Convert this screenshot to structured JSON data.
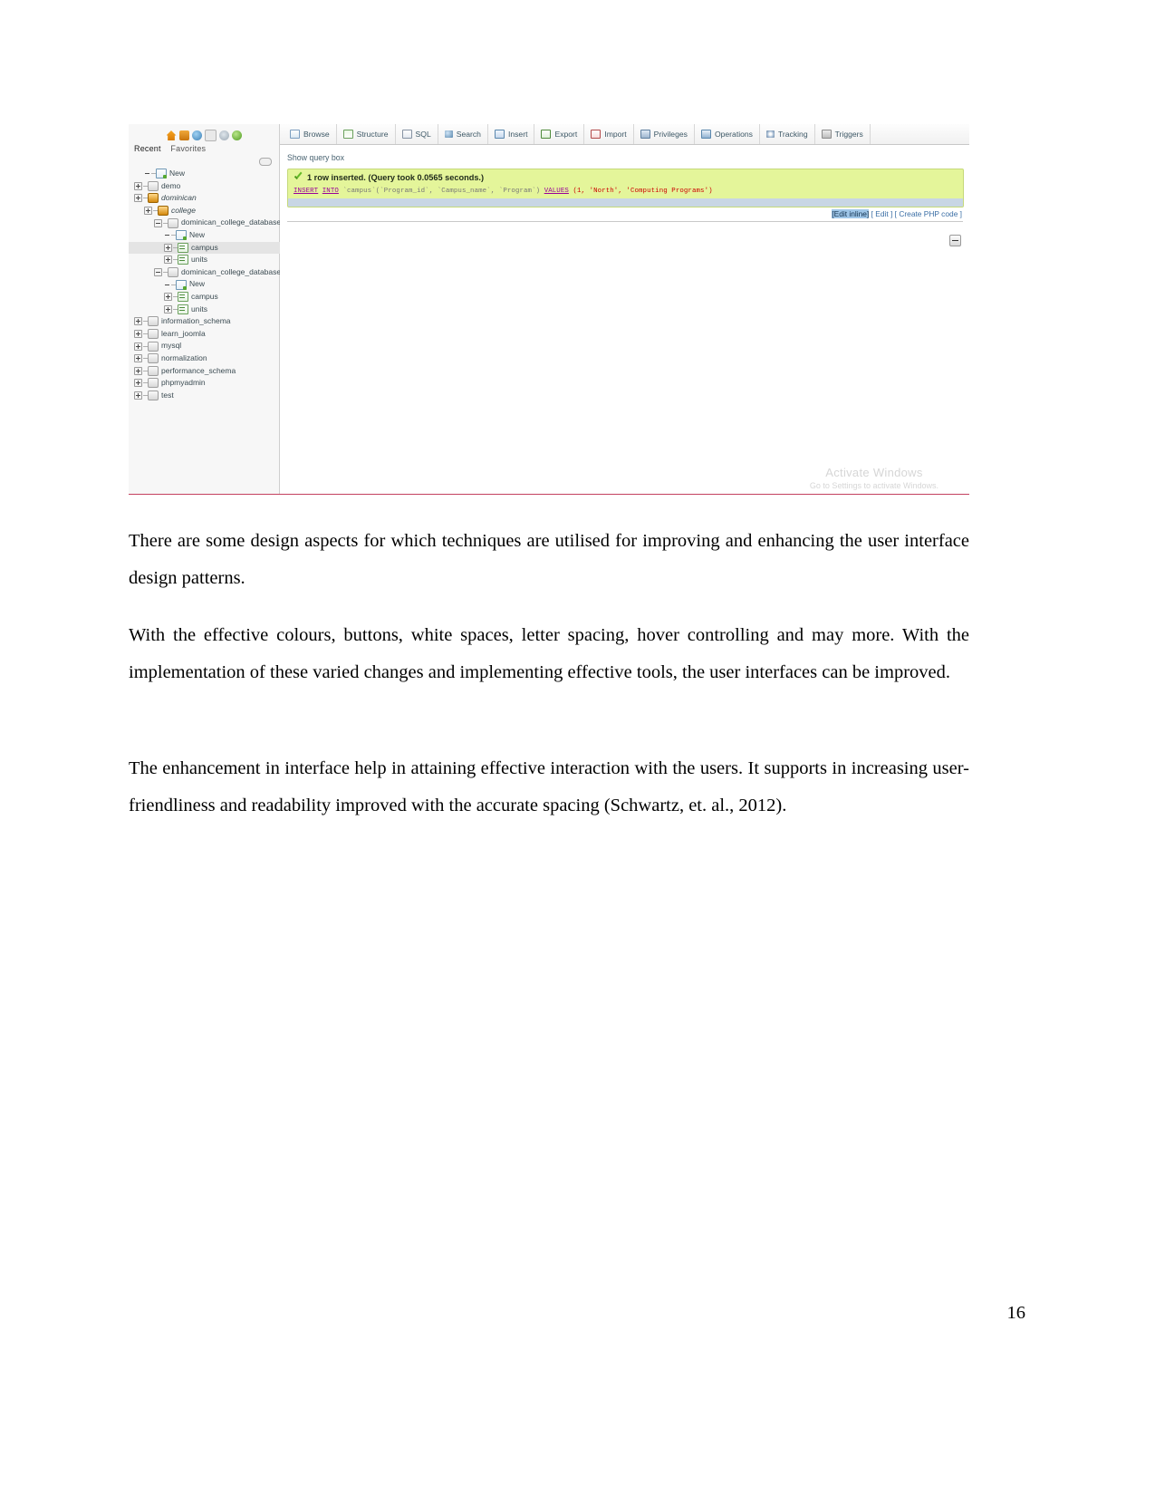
{
  "figure": {
    "sidebar": {
      "logo_icons": [
        "home-icon",
        "sql-query-icon",
        "documentation-icon",
        "manual-icon",
        "settings-icon",
        "refresh-icon"
      ],
      "tabs": [
        {
          "label": "Recent"
        },
        {
          "label": "Favorites"
        }
      ],
      "collapse_label": "",
      "tree": [
        {
          "label": "New",
          "toggle": "none",
          "icon": "new-db-icon",
          "depth": 1,
          "italic": false,
          "selected": false
        },
        {
          "label": "demo",
          "toggle": "plus",
          "icon": "db-icon",
          "depth": 0,
          "italic": false,
          "selected": false
        },
        {
          "label": "dominican",
          "toggle": "plus",
          "icon": "db-open-icon",
          "depth": 0,
          "italic": true,
          "selected": false
        },
        {
          "label": "college",
          "toggle": "plus",
          "icon": "db-open-icon",
          "depth": 1,
          "italic": true,
          "selected": false
        },
        {
          "label": "dominican_college_database",
          "toggle": "minus",
          "icon": "db-icon",
          "depth": 2,
          "italic": false,
          "selected": false
        },
        {
          "label": "New",
          "toggle": "none",
          "icon": "new-table-icon",
          "depth": 3,
          "italic": false,
          "selected": false
        },
        {
          "label": "campus",
          "toggle": "plus",
          "icon": "table-icon",
          "depth": 3,
          "italic": false,
          "selected": true
        },
        {
          "label": "units",
          "toggle": "plus",
          "icon": "table-icon",
          "depth": 3,
          "italic": false,
          "selected": false
        },
        {
          "label": "dominican_college_database",
          "toggle": "minus",
          "icon": "db-icon",
          "depth": 2,
          "italic": false,
          "selected": false
        },
        {
          "label": "New",
          "toggle": "none",
          "icon": "new-table-icon",
          "depth": 3,
          "italic": false,
          "selected": false
        },
        {
          "label": "campus",
          "toggle": "plus",
          "icon": "table-icon",
          "depth": 3,
          "italic": false,
          "selected": false
        },
        {
          "label": "units",
          "toggle": "plus",
          "icon": "table-icon",
          "depth": 3,
          "italic": false,
          "selected": false
        },
        {
          "label": "information_schema",
          "toggle": "plus",
          "icon": "db-icon",
          "depth": 0,
          "italic": false,
          "selected": false
        },
        {
          "label": "learn_joomla",
          "toggle": "plus",
          "icon": "db-icon",
          "depth": 0,
          "italic": false,
          "selected": false
        },
        {
          "label": "mysql",
          "toggle": "plus",
          "icon": "db-icon",
          "depth": 0,
          "italic": false,
          "selected": false
        },
        {
          "label": "normalization",
          "toggle": "plus",
          "icon": "db-icon",
          "depth": 0,
          "italic": false,
          "selected": false
        },
        {
          "label": "performance_schema",
          "toggle": "plus",
          "icon": "db-icon",
          "depth": 0,
          "italic": false,
          "selected": false
        },
        {
          "label": "phpmyadmin",
          "toggle": "plus",
          "icon": "db-icon",
          "depth": 0,
          "italic": false,
          "selected": false
        },
        {
          "label": "test",
          "toggle": "plus",
          "icon": "db-icon",
          "depth": 0,
          "italic": false,
          "selected": false
        }
      ]
    },
    "tabs": [
      {
        "label": "Browse",
        "icon": "browse-icon"
      },
      {
        "label": "Structure",
        "icon": "structure-icon"
      },
      {
        "label": "SQL",
        "icon": "sql-icon"
      },
      {
        "label": "Search",
        "icon": "search-icon"
      },
      {
        "label": "Insert",
        "icon": "insert-icon"
      },
      {
        "label": "Export",
        "icon": "export-icon"
      },
      {
        "label": "Import",
        "icon": "import-icon"
      },
      {
        "label": "Privileges",
        "icon": "privileges-icon"
      },
      {
        "label": "Operations",
        "icon": "operations-icon"
      },
      {
        "label": "Tracking",
        "icon": "tracking-icon"
      },
      {
        "label": "Triggers",
        "icon": "triggers-icon"
      }
    ],
    "show_query_box": "Show query box",
    "result_message": "1 row inserted. (Query took 0.0565 seconds.)",
    "sql": {
      "keyword1": "INSERT",
      "keyword2": "INTO",
      "table": "`campus`",
      "columns": "(`Program_id`, `Campus_name`, `Program`)",
      "values_keyword": "VALUES",
      "values": "(1, 'North', 'Computing Programs')",
      "full": "INSERT INTO `campus`(`Program_id`, `Campus_name`, `Program`) VALUES (1, 'North', 'Computing Programs')"
    },
    "links": {
      "edit_inline": "[Edit inline]",
      "edit": "[ Edit ]",
      "create_php": "[ Create PHP code ]"
    },
    "collapse_button": "minus-button",
    "watermark": {
      "line1": "Activate Windows",
      "line2": "Go to Settings to activate Windows."
    }
  },
  "document": {
    "paragraphs": [
      "There are some design aspects for which techniques are utilised for improving and enhancing the user interface design patterns.",
      "With the effective colours, buttons, white spaces, letter spacing, hover controlling and may more. With the implementation of these varied changes and implementing effective tools, the user interfaces can be improved.",
      "The enhancement in interface help in attaining effective interaction with the users. It supports in increasing user-friendliness and readability improved with the accurate spacing (Schwartz, et. al., 2012)."
    ],
    "page_number": "16"
  }
}
